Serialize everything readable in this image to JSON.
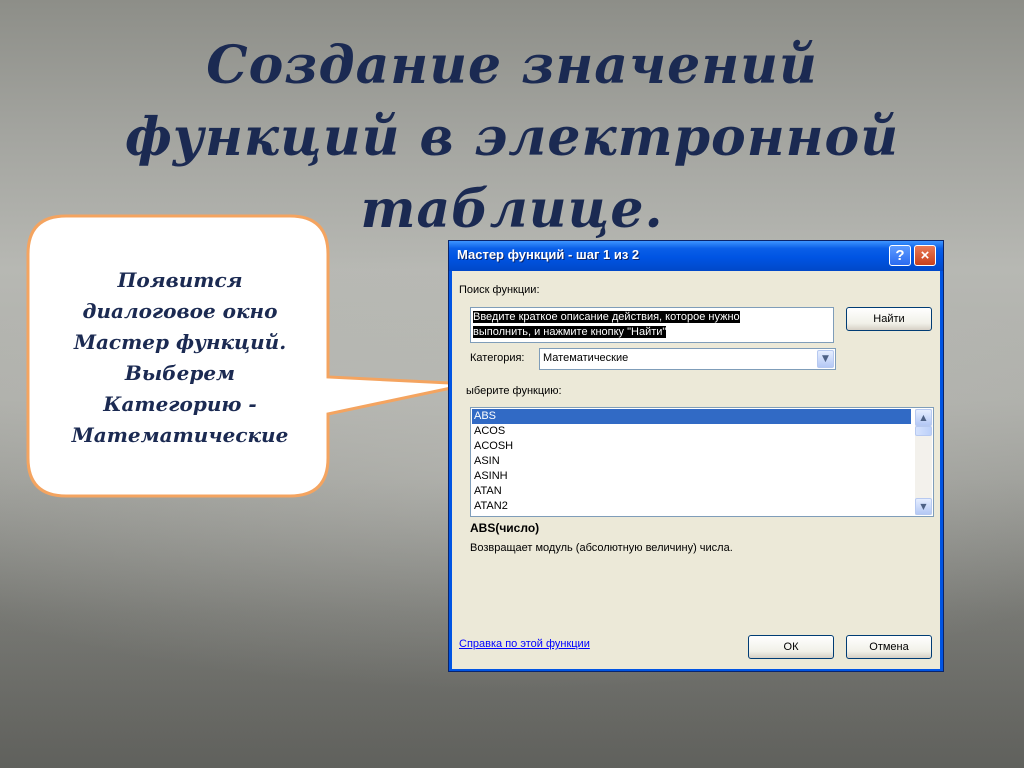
{
  "slide": {
    "title_lines": [
      "Создание значений",
      "функций в электронной",
      "таблице."
    ]
  },
  "callout": {
    "lines": [
      "Появится",
      "диалоговое окно",
      "Мастер функций.",
      "Выберем",
      "Категорию -",
      "Математические"
    ],
    "fill": "#ffffff",
    "border_color": "#f4a460"
  },
  "dialog": {
    "title": "Мастер функций - шаг 1 из 2",
    "help_glyph": "?",
    "close_glyph": "×",
    "search_label": "Поиск функции:",
    "search_text_line1": "Введите краткое описание действия, которое нужно",
    "search_text_line2": "выполнить, и нажмите кнопку \"Найти\"",
    "find_button": "Найти",
    "category_label": "Категория:",
    "category_value": "Математические",
    "choose_label": "ыберите функцию:",
    "functions": [
      "ABS",
      "ACOS",
      "ACOSH",
      "ASIN",
      "ASINH",
      "ATAN",
      "ATAN2"
    ],
    "selected_function": "ABS",
    "signature": "ABS(число)",
    "description": "Возвращает модуль (абсолютную величину) числа.",
    "help_link": "Справка по этой функции",
    "ok_button": "ОК",
    "cancel_button": "Отмена"
  },
  "colors": {
    "title_color": "#1b2a52",
    "titlebar_blue": "#0054e3",
    "selection_blue": "#316ac5",
    "dialog_face": "#ece9d8"
  },
  "icons": {
    "dropdown": "chevron-down-icon",
    "scroll_up": "chevron-up-icon",
    "scroll_down": "chevron-down-icon"
  }
}
